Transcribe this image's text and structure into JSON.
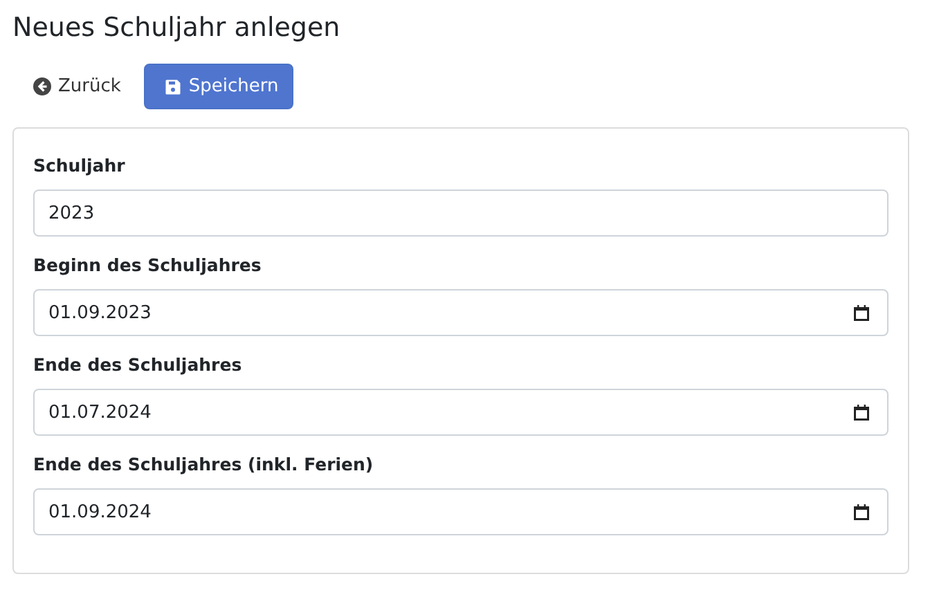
{
  "title": "Neues Schuljahr anlegen",
  "buttons": [
    {
      "kind": "back",
      "label": "Zurück"
    },
    {
      "kind": "save",
      "label": "Speichern"
    }
  ],
  "fields": [
    {
      "kind": "text",
      "label": "Schuljahr",
      "value": "2023"
    },
    {
      "kind": "date",
      "label": "Beginn des Schuljahres",
      "value": "01.09.2023"
    },
    {
      "kind": "date",
      "label": "Ende des Schuljahres",
      "value": "01.07.2024"
    },
    {
      "kind": "date",
      "label": "Ende des Schuljahres (inkl. Ferien)",
      "value": "01.09.2024"
    }
  ]
}
